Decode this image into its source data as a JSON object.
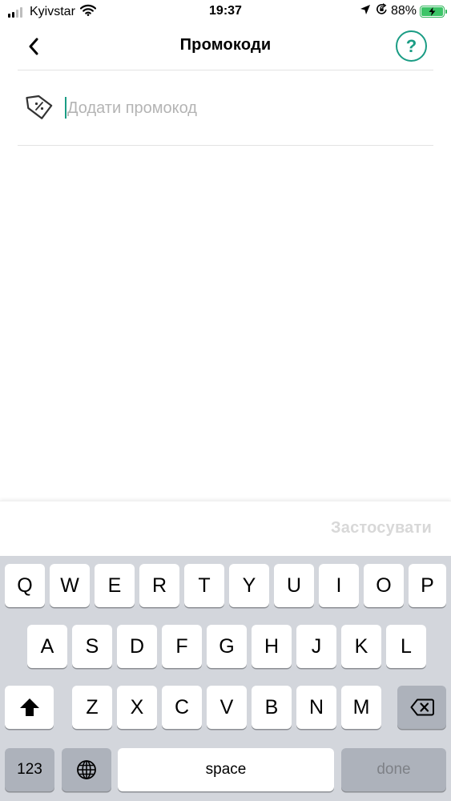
{
  "status_bar": {
    "carrier": "Kyivstar",
    "time": "19:37",
    "battery_percent": "88%",
    "signal_bars_active": 2,
    "signal_bars_total": 4,
    "icons": [
      "signal-icon",
      "wifi-icon",
      "location-arrow-icon",
      "orientation-lock-icon",
      "battery-charging-icon"
    ]
  },
  "nav": {
    "title": "Промокоди",
    "back_icon": "chevron-left-icon",
    "help_label": "?"
  },
  "promo": {
    "placeholder": "Додати промокод",
    "value": "",
    "icon": "discount-tag-icon"
  },
  "apply": {
    "label": "Застосувати",
    "enabled": false
  },
  "keyboard": {
    "row1": [
      "Q",
      "W",
      "E",
      "R",
      "T",
      "Y",
      "U",
      "I",
      "O",
      "P"
    ],
    "row2": [
      "A",
      "S",
      "D",
      "F",
      "G",
      "H",
      "J",
      "K",
      "L"
    ],
    "row3": [
      "Z",
      "X",
      "C",
      "V",
      "B",
      "N",
      "M"
    ],
    "numbers_label": "123",
    "space_label": "space",
    "done_label": "done",
    "shift_icon": "shift-icon",
    "backspace_icon": "backspace-icon",
    "globe_icon": "globe-icon"
  },
  "colors": {
    "accent": "#1a9c84",
    "battery": "#3cc467",
    "disabled_text": "#d8d8d8",
    "keyboard_bg": "#d3d6dc"
  }
}
